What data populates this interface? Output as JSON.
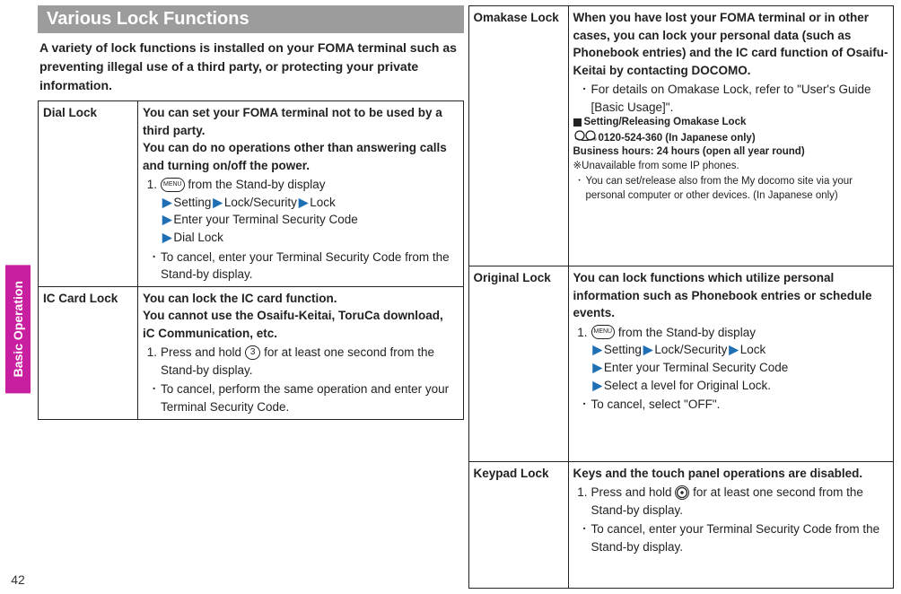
{
  "sidebar": {
    "tab": "Basic Operation",
    "page_number": "42"
  },
  "heading": "Various Lock Functions",
  "intro": "A variety of lock functions is installed on your FOMA terminal such as preventing illegal use of a third party, or protecting your private information.",
  "dial_lock": {
    "name": "Dial Lock",
    "desc": "You can set your FOMA terminal not to be used by a third party.\nYou can do no operations other than answering calls and turning on/off the power.",
    "step_prefix": "1. ",
    "step_from": " from the Stand-by display",
    "p1": "Setting",
    "p2": "Lock/Security",
    "p3": "Lock",
    "p4": "Enter your Terminal Security Code",
    "p5": "Dial Lock",
    "cancel": "To cancel, enter your Terminal Security Code from the Stand-by display."
  },
  "ic_card_lock": {
    "name": "IC Card Lock",
    "desc": "You can lock the IC card function.\nYou cannot use the Osaifu-Keitai, ToruCa download, iC Communication, etc.",
    "step_prefix": "1. Press and hold ",
    "step_suffix": " for at least one second from the Stand-by display.",
    "cancel": "To cancel, perform the same operation and enter your Terminal Security Code."
  },
  "omakase_lock": {
    "name": "Omakase Lock",
    "desc": "When you have lost your FOMA terminal or in other cases, you can lock your personal data (such as Phonebook entries) and the IC card function of Osaifu-Keitai by contacting DOCOMO.",
    "detail": "For details on Omakase Lock, refer to \"User's Guide [Basic Usage]\".",
    "subhead": "Setting/Releasing Omakase Lock",
    "phone": "0120-524-360 (In Japanese only)",
    "hours": "Business hours: 24 hours (open all year round)",
    "note1": "※Unavailable from some IP phones.",
    "note2": "You can set/release also from the My docomo site via your personal computer or other devices. (In Japanese only)"
  },
  "original_lock": {
    "name": "Original Lock",
    "desc": "You can lock functions which utilize personal information such as Phonebook entries or schedule events.",
    "step_prefix": "1. ",
    "step_from": " from the Stand-by display",
    "p1": "Setting",
    "p2": "Lock/Security",
    "p3": "Lock",
    "p4": "Enter your Terminal Security Code",
    "p5": "Select a level for Original Lock.",
    "cancel": "To cancel, select \"OFF\"."
  },
  "keypad_lock": {
    "name": "Keypad Lock",
    "desc": "Keys and the touch panel operations are disabled.",
    "step_prefix": "1. Press and hold ",
    "step_suffix": " for at least one second from the Stand-by display.",
    "cancel": "To cancel, enter your Terminal Security Code from the Stand-by display."
  },
  "keys": {
    "menu": "MENU",
    "three": "3"
  }
}
